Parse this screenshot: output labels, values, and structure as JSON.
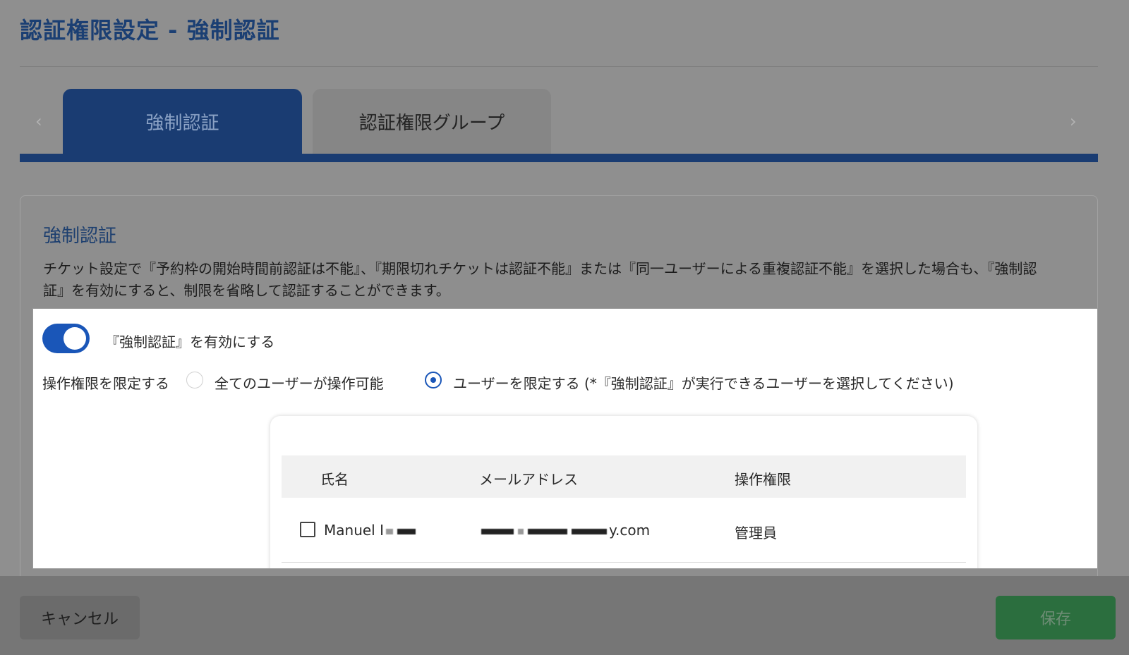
{
  "page": {
    "title": "認証権限設定 - 強制認証"
  },
  "tabs": [
    {
      "label": "強制認証",
      "active": true
    },
    {
      "label": "認証権限グループ",
      "active": false
    }
  ],
  "tab_nav": {
    "prev_icon": "‹",
    "next_icon": "›"
  },
  "section": {
    "title": "強制認証",
    "description": "チケット設定で『予約枠の開始時間前認証は不能』、『期限切れチケットは認証不能』または『同一ユーザーによる重複認証不能』を選択した場合も、『強制認証』を有効にすると、制限を省略して認証することができます。"
  },
  "toggle": {
    "label": "『強制認証』を有効にする",
    "enabled": true
  },
  "permission": {
    "label": "操作権限を限定する",
    "options": [
      {
        "label": "全てのユーザーが操作可能",
        "selected": false
      },
      {
        "label": "ユーザーを限定する (*『強制認証』が実行できるユーザーを選択してください)",
        "selected": true
      }
    ]
  },
  "user_table": {
    "columns": [
      "氏名",
      "メールアドレス",
      "操作権限"
    ],
    "rows": [
      {
        "name": "Manuel I",
        "email_suffix": "y.com",
        "role": "管理員",
        "checked": false
      }
    ]
  },
  "footer": {
    "cancel_label": "キャンセル",
    "save_label": "保存"
  },
  "colors": {
    "primary": "#1a3c72",
    "toggle": "#1a56b8",
    "save": "#2b6e3e"
  }
}
